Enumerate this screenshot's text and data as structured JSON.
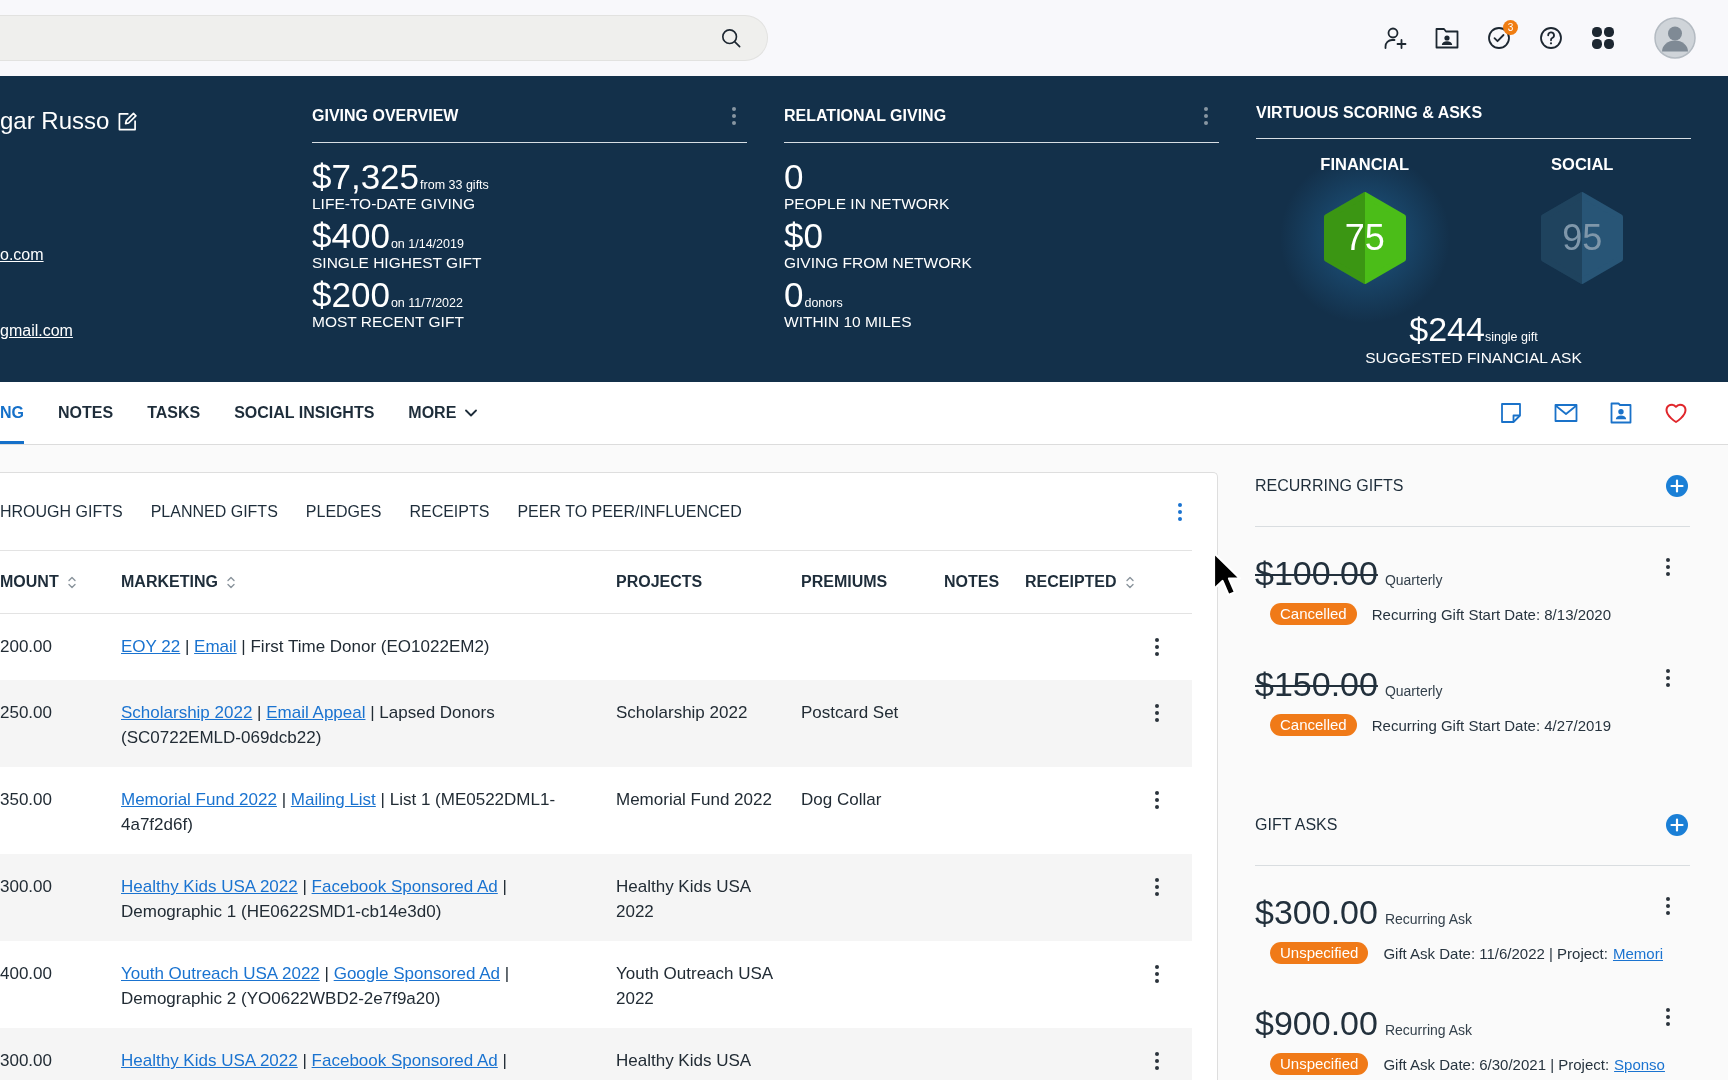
{
  "top_bar": {
    "notification_count": "3"
  },
  "profile": {
    "name": "gar Russo",
    "emails": [
      "o.com",
      "gmail.com"
    ]
  },
  "giving_overview": {
    "title": "GIVING OVERVIEW",
    "stats": [
      {
        "value": "$7,325",
        "note": "from 33 gifts",
        "label": "LIFE-TO-DATE GIVING"
      },
      {
        "value": "$400",
        "note": "on 1/14/2019",
        "label": "SINGLE HIGHEST GIFT"
      },
      {
        "value": "$200",
        "note": "on 11/7/2022",
        "label": "MOST RECENT GIFT"
      }
    ]
  },
  "relational_giving": {
    "title": "RELATIONAL GIVING",
    "stats": [
      {
        "value": "0",
        "label": "PEOPLE IN NETWORK"
      },
      {
        "value": "$0",
        "label": "GIVING FROM NETWORK"
      },
      {
        "value": "0",
        "note": "donors",
        "label": "WITHIN 10 MILES"
      }
    ]
  },
  "scoring": {
    "title": "VIRTUOUS SCORING & ASKS",
    "scores": [
      {
        "label": "FINANCIAL",
        "value": "75",
        "color": "#4bbd18",
        "highlighted": true
      },
      {
        "label": "SOCIAL",
        "value": "95",
        "color": "#285576",
        "highlighted": false
      }
    ],
    "ask": {
      "value": "$244",
      "note": "single gift",
      "label": "SUGGESTED FINANCIAL ASK"
    }
  },
  "tabs": [
    {
      "label": "NG",
      "kind": "tab",
      "selected": true
    },
    {
      "label": "NOTES",
      "kind": "tab",
      "selected": false
    },
    {
      "label": "TASKS",
      "kind": "tab",
      "selected": false
    },
    {
      "label": "SOCIAL INSIGHTS",
      "kind": "tab",
      "selected": false
    },
    {
      "label": "MORE",
      "kind": "menu",
      "selected": false
    }
  ],
  "gift_tabs": [
    "HROUGH GIFTS",
    "PLANNED GIFTS",
    "PLEDGES",
    "RECEIPTS",
    "PEER TO PEER/INFLUENCED"
  ],
  "table": {
    "columns": [
      {
        "label": "MOUNT",
        "sortable": true
      },
      {
        "label": "MARKETING",
        "sortable": true
      },
      {
        "label": "PROJECTS",
        "sortable": false
      },
      {
        "label": "PREMIUMS",
        "sortable": false
      },
      {
        "label": "NOTES",
        "sortable": false
      },
      {
        "label": "RECEIPTED",
        "sortable": true
      }
    ],
    "rows": [
      {
        "amount": "200.00",
        "marketing": [
          {
            "kind": "link",
            "text": "EOY 22"
          },
          {
            "kind": "text",
            "text": " | "
          },
          {
            "kind": "link",
            "text": "Email"
          },
          {
            "kind": "text",
            "text": " | First Time Donor (EO1022EM2)"
          }
        ]
      },
      {
        "amount": "250.00",
        "marketing": [
          {
            "kind": "link",
            "text": "Scholarship 2022"
          },
          {
            "kind": "text",
            "text": " | "
          },
          {
            "kind": "link",
            "text": "Email Appeal"
          },
          {
            "kind": "text",
            "text": " | Lapsed Donors (SC0722EMLD-069dcb22)"
          }
        ],
        "project": "Scholarship 2022",
        "premium": "Postcard Set"
      },
      {
        "amount": "350.00",
        "marketing": [
          {
            "kind": "link",
            "text": "Memorial Fund 2022"
          },
          {
            "kind": "text",
            "text": " | "
          },
          {
            "kind": "link",
            "text": "Mailing List"
          },
          {
            "kind": "text",
            "text": " | List 1 (ME0522DML1-4a7f2d6f)"
          }
        ],
        "project": "Memorial Fund 2022",
        "premium": "Dog Collar"
      },
      {
        "amount": "300.00",
        "marketing": [
          {
            "kind": "link",
            "text": "Healthy Kids USA 2022"
          },
          {
            "kind": "text",
            "text": " | "
          },
          {
            "kind": "link",
            "text": "Facebook Sponsored Ad"
          },
          {
            "kind": "text",
            "text": " | Demographic 1 (HE0622SMD1-cb14e3d0)"
          }
        ],
        "project": "Healthy Kids USA 2022"
      },
      {
        "amount": "400.00",
        "marketing": [
          {
            "kind": "link",
            "text": "Youth Outreach USA 2022"
          },
          {
            "kind": "text",
            "text": " | "
          },
          {
            "kind": "link",
            "text": "Google Sponsored Ad"
          },
          {
            "kind": "text",
            "text": " | Demographic 2 (YO0622WBD2-2e7f9a20)"
          }
        ],
        "project": "Youth Outreach USA 2022"
      },
      {
        "amount": "300.00",
        "marketing": [
          {
            "kind": "link",
            "text": "Healthy Kids USA 2022"
          },
          {
            "kind": "text",
            "text": " | "
          },
          {
            "kind": "link",
            "text": "Facebook Sponsored Ad"
          },
          {
            "kind": "text",
            "text": " |"
          }
        ],
        "project": "Healthy Kids USA"
      }
    ]
  },
  "recurring_gifts": {
    "title": "RECURRING GIFTS",
    "items": [
      {
        "amount": "$100.00",
        "struck": true,
        "frequency": "Quarterly",
        "status": "Cancelled",
        "detail": "Recurring Gift Start Date: 8/13/2020"
      },
      {
        "amount": "$150.00",
        "struck": true,
        "frequency": "Quarterly",
        "status": "Cancelled",
        "detail": "Recurring Gift Start Date: 4/27/2019"
      }
    ]
  },
  "gift_asks": {
    "title": "GIFT ASKS",
    "items": [
      {
        "amount": "$300.00",
        "struck": false,
        "frequency": "Recurring Ask",
        "status": "Unspecified",
        "detail": "Gift Ask Date: 11/6/2022 | Project:",
        "link": "Memori"
      },
      {
        "amount": "$900.00",
        "struck": false,
        "frequency": "Recurring Ask",
        "status": "Unspecified",
        "detail": "Gift Ask Date: 6/30/2021 | Project:",
        "link": "Sponso"
      }
    ]
  }
}
